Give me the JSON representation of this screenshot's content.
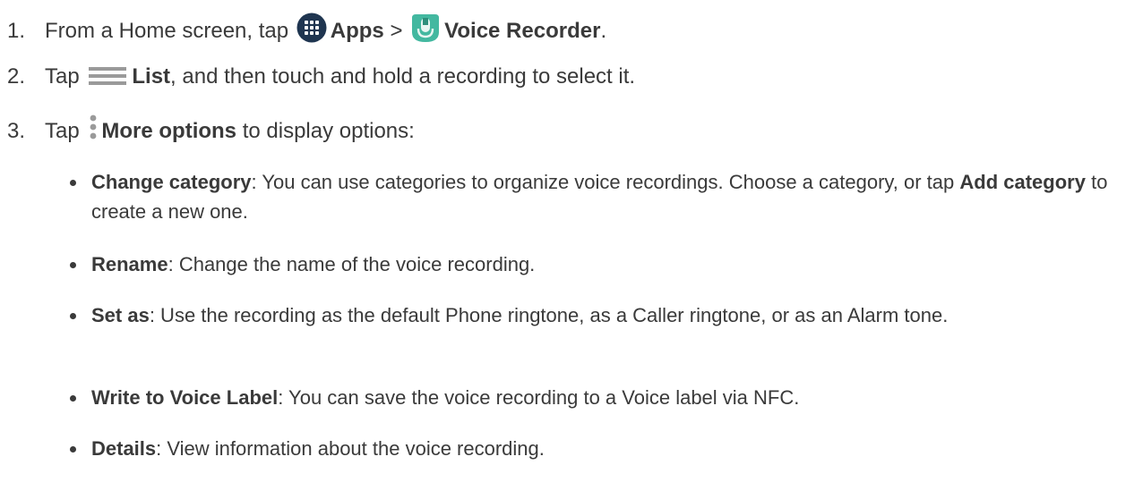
{
  "steps": [
    {
      "number": "1.",
      "prefix": "From a Home screen, tap",
      "apps_label": "Apps",
      "separator": ">",
      "voice_recorder_label": "Voice Recorder",
      "suffix": "."
    },
    {
      "number": "2.",
      "prefix": "Tap",
      "list_label": "List",
      "suffix": ", and then touch and hold a recording to select it."
    },
    {
      "number": "3.",
      "prefix": "Tap",
      "more_options_label": "More options",
      "suffix": "to display options:"
    }
  ],
  "options": [
    {
      "term": "Change category",
      "text_a": ": You can use categories to organize voice recordings. Choose a category, or tap",
      "term2": "Add category",
      "text_b": "to create a new one."
    },
    {
      "term": "Rename",
      "text_a": ": Change the name of the voice recording."
    },
    {
      "term": "Set as",
      "text_a": ": Use the recording as the default Phone ringtone, as a Caller ringtone, or as an Alarm tone."
    },
    {
      "term": "Write to Voice Label",
      "text_a": ": You can save the voice recording to a Voice label via NFC."
    },
    {
      "term": "Details",
      "text_a": ": View information about the voice recording."
    }
  ],
  "icons": {
    "apps": "apps-grid-icon",
    "voice_recorder": "voice-recorder-icon",
    "list": "list-menu-icon",
    "more_options": "more-options-icon"
  },
  "colors": {
    "text": "#3a3a3a",
    "apps_icon_bg": "#1f3550",
    "voice_recorder_green": "#43b8a0",
    "list_icon": "#9a9a9a"
  }
}
